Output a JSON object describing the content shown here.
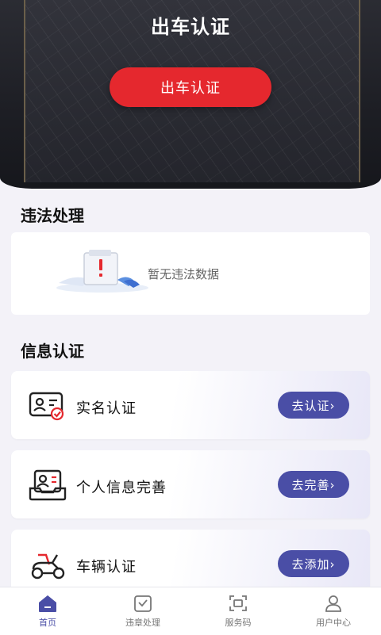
{
  "hero": {
    "title": "出车认证",
    "button_label": "出车认证"
  },
  "violation": {
    "section_title": "违法处理",
    "empty_text": "暂无违法数据"
  },
  "info": {
    "section_title": "信息认证",
    "items": [
      {
        "label": "实名认证",
        "button": "去认证›",
        "icon": "id-card-icon"
      },
      {
        "label": "个人信息完善",
        "button": "去完善›",
        "icon": "profile-tray-icon"
      },
      {
        "label": "车辆认证",
        "button": "去添加›",
        "icon": "scooter-icon"
      }
    ]
  },
  "tabbar": {
    "tabs": [
      {
        "label": "首页",
        "icon": "home-icon",
        "active": true
      },
      {
        "label": "违章处理",
        "icon": "ticket-check-icon"
      },
      {
        "label": "服务码",
        "icon": "scan-code-icon"
      },
      {
        "label": "用户中心",
        "icon": "user-icon"
      }
    ]
  },
  "colors": {
    "accent": "#4a4ea6",
    "primary_red": "#e5282e"
  }
}
